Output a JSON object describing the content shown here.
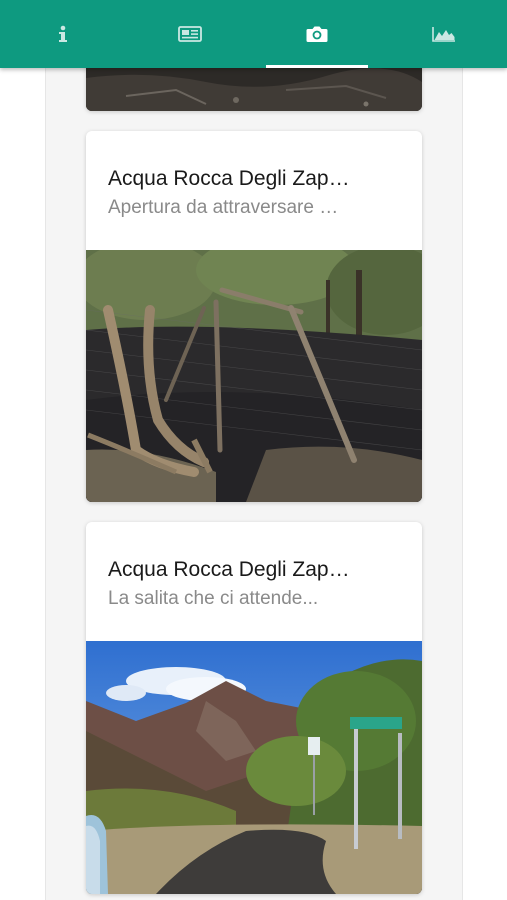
{
  "tabs": [
    {
      "name": "info-icon",
      "active": false
    },
    {
      "name": "newspaper-icon",
      "active": false
    },
    {
      "name": "camera-icon",
      "active": true
    },
    {
      "name": "elevation-chart-icon",
      "active": false
    }
  ],
  "colors": {
    "accent": "#0e9a80",
    "title": "#1a1a1a",
    "subtitle": "#8a8a8a"
  },
  "cards": [
    {
      "title": "Acqua Rocca Degli Zap…",
      "subtitle": "Apertura da attraversare …"
    },
    {
      "title": "Acqua Rocca Degli Zap…",
      "subtitle": "La salita che ci attende..."
    }
  ]
}
